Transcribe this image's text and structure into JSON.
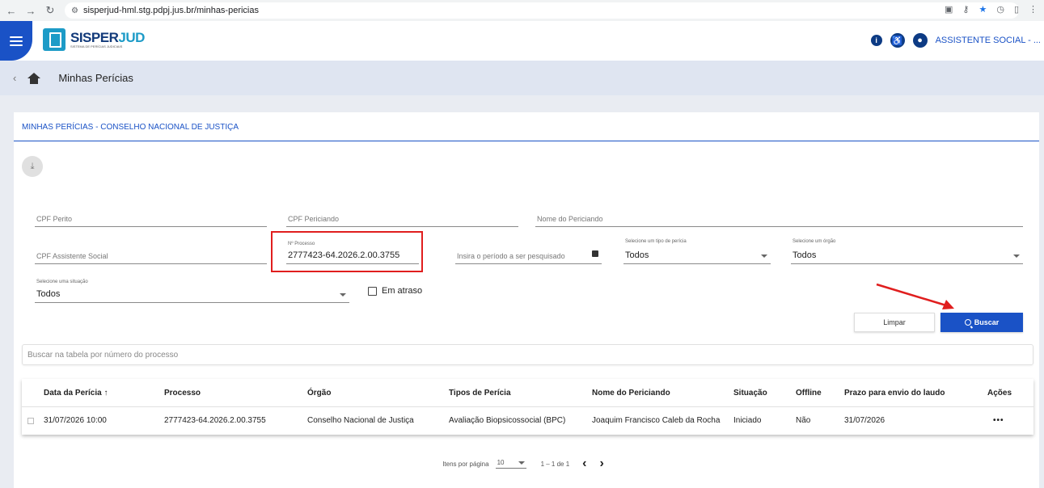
{
  "browser": {
    "url": "sisperjud-hml.stg.pdpj.jus.br/minhas-pericias"
  },
  "header": {
    "logo_title_a": "SISPER",
    "logo_title_b": "JUD",
    "logo_sub": "SISTEMA DE PERÍCIAS JUDICIAIS",
    "user_name": "ASSISTENTE SOCIAL - ..."
  },
  "breadcrumb": {
    "title": "Minhas Perícias"
  },
  "card": {
    "title": "MINHAS PERÍCIAS - CONSELHO NACIONAL DE JUSTIÇA"
  },
  "filters": {
    "cpf_perito": "CPF Perito",
    "cpf_periciando": "CPF Periciando",
    "nome_periciando": "Nome do Periciando",
    "cpf_assistente": "CPF Assistente Social",
    "processo_label": "Nº Processo",
    "processo_value": "2777423-64.2026.2.00.3755",
    "periodo": "Insira o período a ser pesquisado",
    "tipo_label": "Selecione um tipo de perícia",
    "tipo_value": "Todos",
    "orgao_label": "Selecione um órgão",
    "orgao_value": "Todos",
    "situacao_label": "Selecione uma situação",
    "situacao_value": "Todos",
    "em_atraso": "Em atraso"
  },
  "buttons": {
    "limpar": "Limpar",
    "buscar": "Buscar"
  },
  "table_search": {
    "placeholder": "Buscar na tabela por número do processo"
  },
  "table": {
    "columns": [
      "Data da Perícia ↑",
      "Processo",
      "Órgão",
      "Tipos de Perícia",
      "Nome do Periciando",
      "Situação",
      "Offline",
      "Prazo para envio do laudo",
      "Ações"
    ],
    "rows": [
      [
        "31/07/2026 10:00",
        "2777423-64.2026.2.00.3755",
        "Conselho Nacional de Justiça",
        "Avaliação Biopsicossocial (BPC)",
        "Joaquim Francisco Caleb da Rocha",
        "Iniciado",
        "Não",
        "31/07/2026",
        "•••"
      ]
    ]
  },
  "pager": {
    "items_label": "Itens por página",
    "page_size": "10",
    "range": "1 – 1 de 1"
  },
  "colors": {
    "primary": "#1a52c6",
    "highlight": "#e01e1e"
  }
}
